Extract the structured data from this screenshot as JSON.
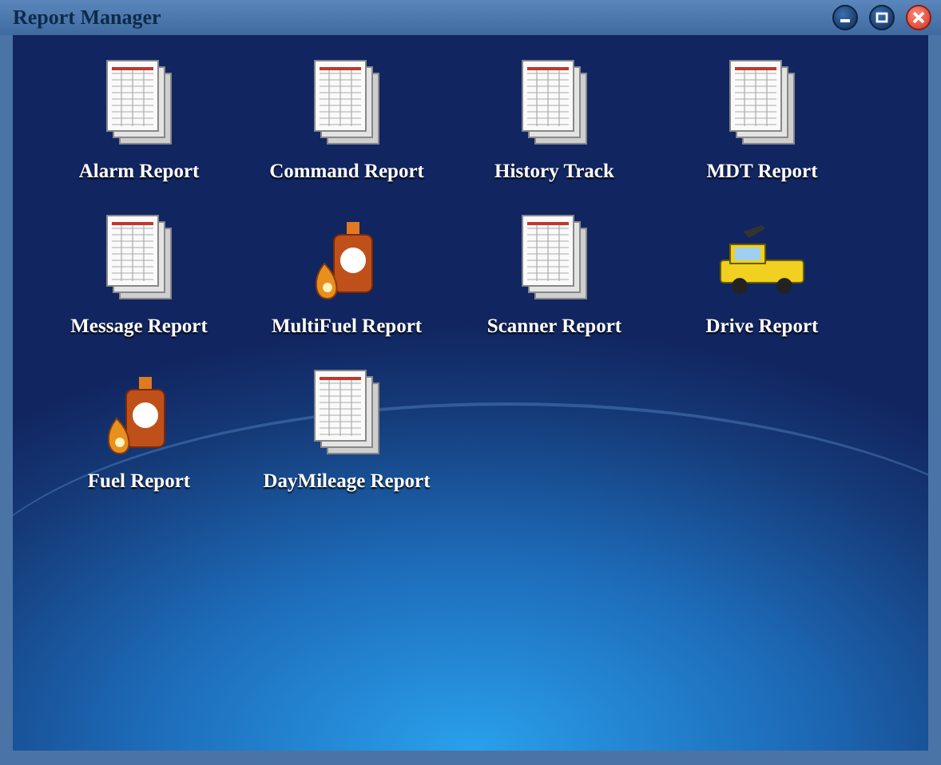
{
  "window": {
    "title": "Report Manager"
  },
  "reports": [
    {
      "label": "Alarm Report",
      "kind": "sheet"
    },
    {
      "label": "Command Report",
      "kind": "sheet"
    },
    {
      "label": "History Track",
      "kind": "sheet"
    },
    {
      "label": "MDT Report",
      "kind": "sheet"
    },
    {
      "label": "Message Report",
      "kind": "sheet"
    },
    {
      "label": "MultiFuel Report",
      "kind": "bottle"
    },
    {
      "label": "Scanner Report",
      "kind": "sheet"
    },
    {
      "label": "Drive Report",
      "kind": "truck"
    },
    {
      "label": "Fuel Report",
      "kind": "bottle"
    },
    {
      "label": "DayMileage Report",
      "kind": "sheet"
    }
  ]
}
